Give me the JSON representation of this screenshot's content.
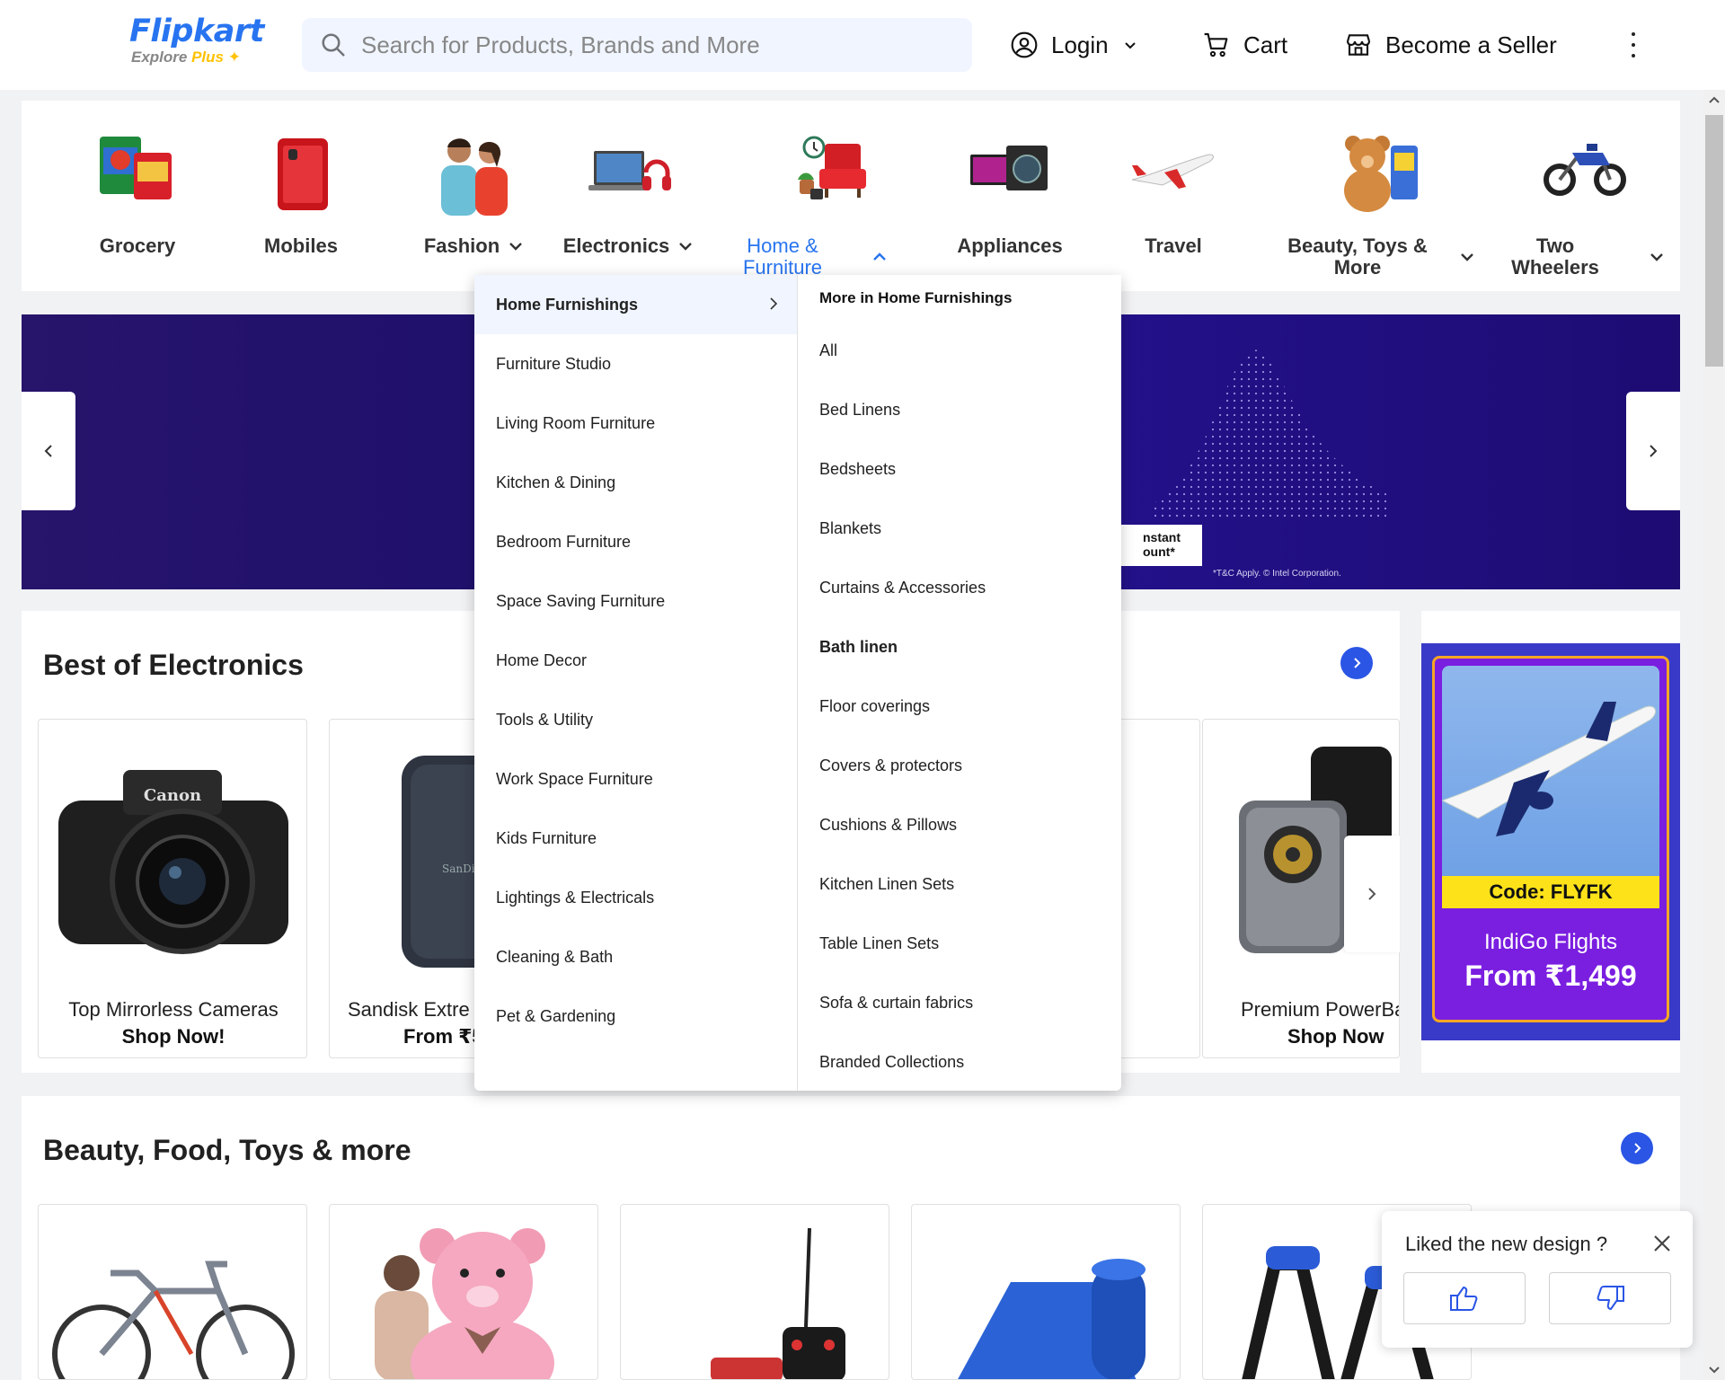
{
  "header": {
    "logo": {
      "brand": "Flipkart",
      "tagline": "Explore",
      "tagline_plus": "Plus"
    },
    "search_placeholder": "Search for Products, Brands and More",
    "login_label": "Login",
    "cart_label": "Cart",
    "seller_label": "Become a Seller"
  },
  "categories": [
    {
      "label": "Grocery",
      "icon": "grocery-icon",
      "dropdown": false
    },
    {
      "label": "Mobiles",
      "icon": "mobile-phone-icon",
      "dropdown": false
    },
    {
      "label": "Fashion",
      "icon": "fashion-people-icon",
      "dropdown": true
    },
    {
      "label": "Electronics",
      "icon": "laptop-icon",
      "dropdown": true
    },
    {
      "label": "Home & Furniture",
      "icon": "armchair-icon",
      "dropdown": true,
      "expanded": true
    },
    {
      "label": "Appliances",
      "icon": "tv-washer-icon",
      "dropdown": false
    },
    {
      "label": "Travel",
      "icon": "airplane-icon",
      "dropdown": false
    },
    {
      "label": "Beauty, Toys & More",
      "icon": "teddy-bear-icon",
      "dropdown": true
    },
    {
      "label": "Two Wheelers",
      "icon": "motorcycle-icon",
      "dropdown": true
    }
  ],
  "banner": {
    "badge_text": "nstant\nount*",
    "tc": "*T&C Apply. © Intel Corporation."
  },
  "mega_menu": {
    "left_items": [
      {
        "label": "Home Furnishings",
        "active": true
      },
      {
        "label": "Furniture Studio"
      },
      {
        "label": "Living Room Furniture"
      },
      {
        "label": "Kitchen & Dining"
      },
      {
        "label": "Bedroom Furniture"
      },
      {
        "label": "Space Saving Furniture"
      },
      {
        "label": "Home Decor"
      },
      {
        "label": "Tools & Utility"
      },
      {
        "label": "Work Space Furniture"
      },
      {
        "label": "Kids Furniture"
      },
      {
        "label": "Lightings & Electricals"
      },
      {
        "label": "Cleaning & Bath"
      },
      {
        "label": "Pet & Gardening"
      }
    ],
    "right_heading": "More in Home Furnishings",
    "right_items": [
      {
        "label": "All"
      },
      {
        "label": "Bed Linens"
      },
      {
        "label": "Bedsheets"
      },
      {
        "label": "Blankets"
      },
      {
        "label": "Curtains & Accessories"
      },
      {
        "label": "Bath linen",
        "bold": true
      },
      {
        "label": "Floor coverings"
      },
      {
        "label": "Covers & protectors"
      },
      {
        "label": "Cushions & Pillows"
      },
      {
        "label": "Kitchen Linen Sets"
      },
      {
        "label": "Table Linen Sets"
      },
      {
        "label": "Sofa & curtain fabrics"
      },
      {
        "label": "Branded Collections"
      }
    ]
  },
  "best_electronics": {
    "title": "Best of Electronics",
    "cards": [
      {
        "name": "Top Mirrorless Cameras",
        "price": "Shop Now!",
        "icon": "camera-icon"
      },
      {
        "name": "Sandisk Extre",
        "price": "From ₹5",
        "icon": "ssd-icon"
      },
      {
        "name": "",
        "price": "",
        "icon": "usb-hub-icon"
      },
      {
        "name": "Premium PowerBa",
        "price": "Shop Now",
        "icon": "powerbank-icon"
      }
    ]
  },
  "ad": {
    "code": "Code: FLYFK",
    "line1": "IndiGo Flights",
    "line2": "From ₹1,499"
  },
  "beauty_section": {
    "title": "Beauty, Food, Toys & more",
    "cards": [
      {
        "icon": "bicycle-icon"
      },
      {
        "icon": "teddy-bear-icon"
      },
      {
        "icon": "rc-car-icon"
      },
      {
        "icon": "yoga-mat-icon"
      },
      {
        "icon": "pushup-bar-icon"
      }
    ]
  },
  "feedback": {
    "title": "Liked the new design ?"
  },
  "colors": {
    "brand_blue": "#2874f0",
    "accent_yellow": "#ffc200",
    "arrow_blue": "#2a55e5"
  }
}
